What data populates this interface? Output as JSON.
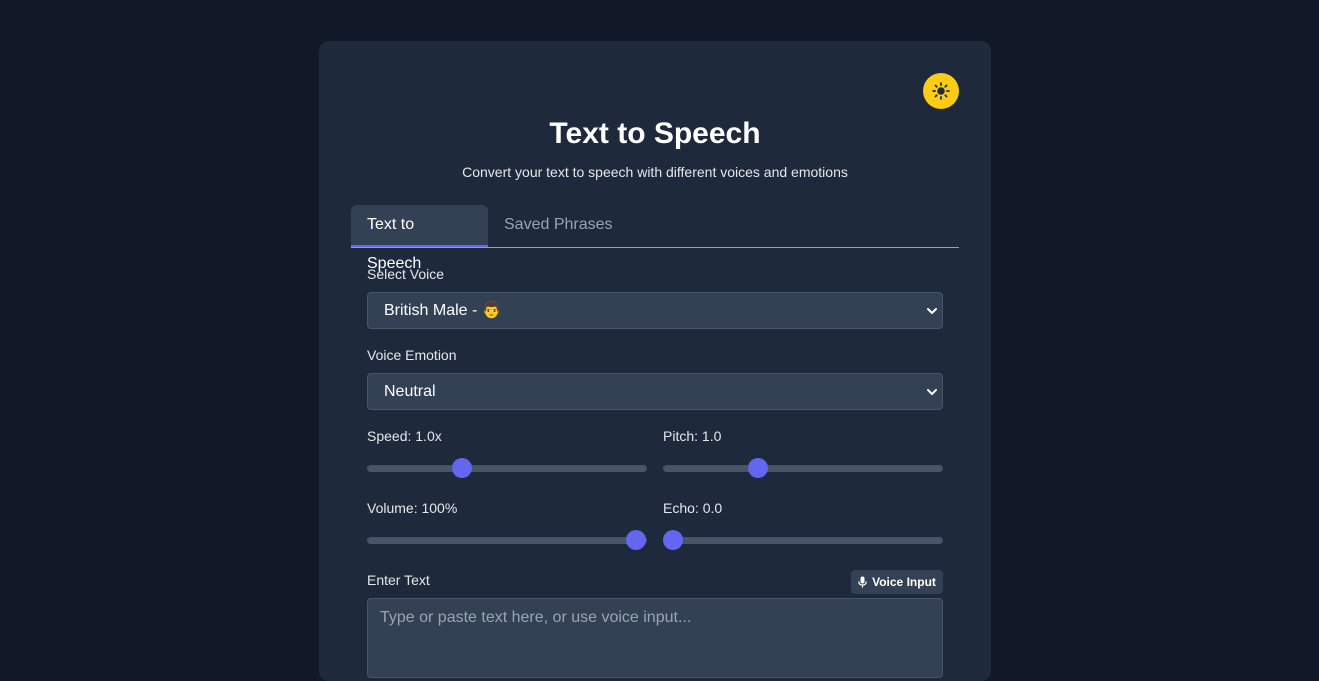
{
  "app": {
    "title": "Text to Speech",
    "subtitle": "Convert your text to speech with different voices and emotions",
    "theme_toggle_icon": "sun-icon"
  },
  "tabs": [
    {
      "label": "Text to Speech",
      "active": true
    },
    {
      "label": "Saved Phrases",
      "active": false
    }
  ],
  "voice": {
    "label": "Select Voice",
    "selected": "British Male - 👨"
  },
  "emotion": {
    "label": "Voice Emotion",
    "selected": "Neutral"
  },
  "controls": {
    "speed": {
      "label": "Speed: 1.0x",
      "value": 0.34
    },
    "pitch": {
      "label": "Pitch: 1.0",
      "value": 0.34
    },
    "volume": {
      "label": "Volume: 100%",
      "value": 0.96
    },
    "echo": {
      "label": "Echo: 0.0",
      "value": 0.036
    }
  },
  "text_input": {
    "label": "Enter Text",
    "voice_input_label": "Voice Input",
    "voice_input_icon": "microphone-icon",
    "placeholder": "Type or paste text here, or use voice input..."
  },
  "colors": {
    "background": "#111827",
    "card": "#1e293b",
    "accent": "#6366f1",
    "theme_toggle": "#facc15"
  }
}
